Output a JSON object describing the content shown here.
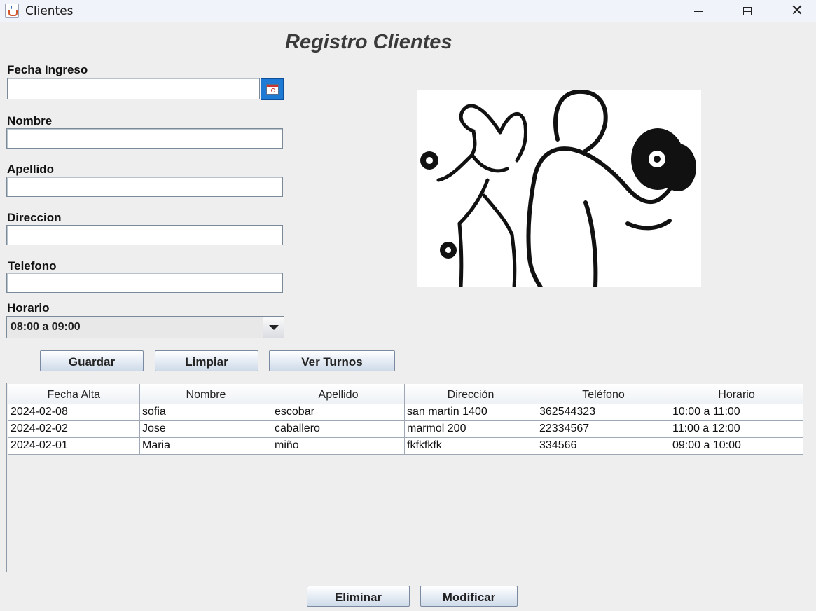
{
  "window": {
    "title": "Clientes"
  },
  "heading": "Registro Clientes",
  "form": {
    "fecha_label": "Fecha Ingreso",
    "fecha_value": "",
    "nombre_label": "Nombre",
    "nombre_value": "",
    "apellido_label": "Apellido",
    "apellido_value": "",
    "direccion_label": "Direccion",
    "direccion_value": "",
    "telefono_label": "Telefono",
    "telefono_value": "",
    "horario_label": "Horario",
    "horario_value": "08:00 a 09:00"
  },
  "buttons": {
    "guardar": "Guardar",
    "limpiar": "Limpiar",
    "ver_turnos": "Ver Turnos",
    "eliminar": "Eliminar",
    "modificar": "Modificar"
  },
  "table": {
    "columns": [
      "Fecha Alta",
      "Nombre",
      "Apellido",
      "Dirección",
      "Teléfono",
      "Horario"
    ],
    "rows": [
      [
        "2024-02-08",
        "sofia",
        "escobar",
        "san martin 1400",
        "362544323",
        "10:00 a 11:00"
      ],
      [
        "2024-02-02",
        "Jose",
        "caballero",
        "marmol 200",
        "22334567",
        "11:00 a 12:00"
      ],
      [
        "2024-02-01",
        "Maria",
        "miño",
        "fkfkfkfk",
        "334566",
        "09:00 a 10:00"
      ]
    ]
  },
  "icons": {
    "app": "java-coffee-icon",
    "calendar": "calendar-icon",
    "dropdown": "chevron-down-icon"
  },
  "colors": {
    "calendar_button": "#1f7ad6"
  }
}
